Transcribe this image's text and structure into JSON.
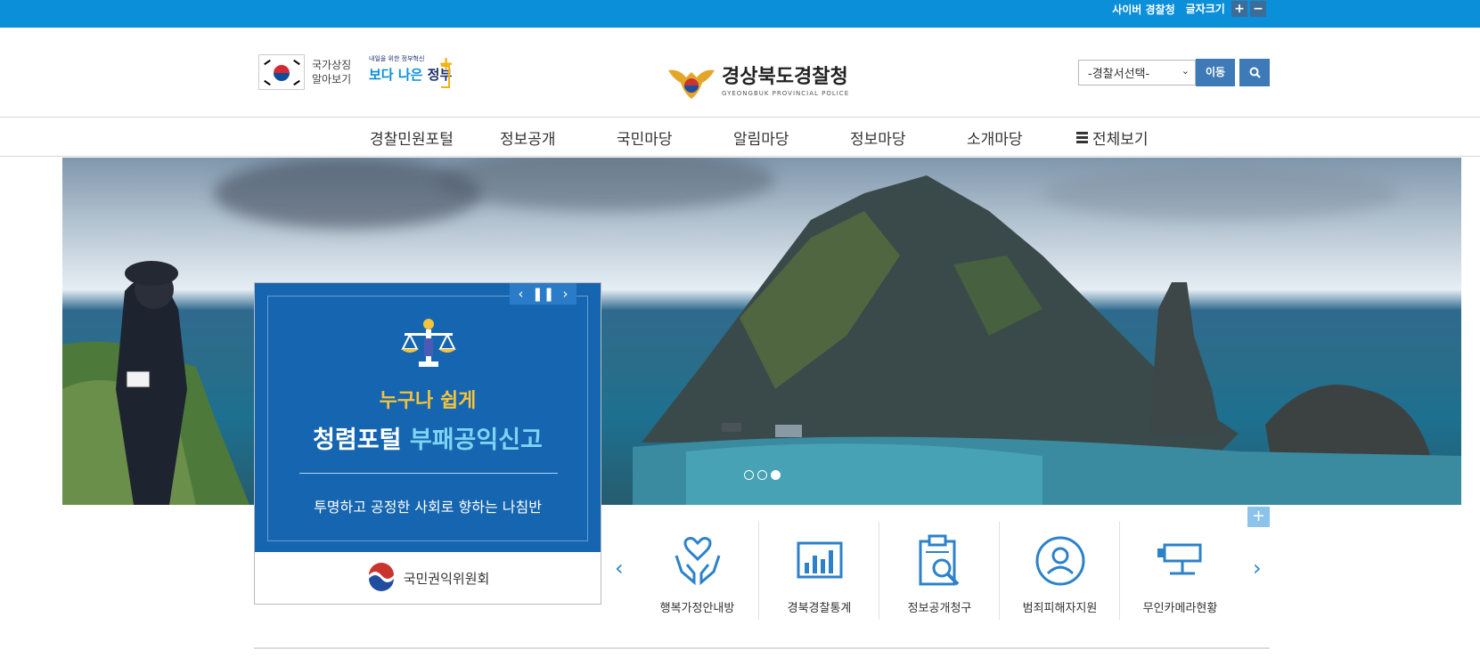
{
  "topbar": {
    "cyber_link": "사이버 경찰청",
    "font_size_label": "글자크기",
    "font_plus": "+",
    "font_minus": "−"
  },
  "header": {
    "symbol_line1": "국가상징",
    "symbol_line2": "알아보기",
    "gov_small": "내일을 위한 정부혁신",
    "gov_big_1": "보다 나은",
    "gov_big_2": "정부",
    "gov_plus": "+",
    "logo_ko": "경상북도경찰청",
    "logo_en": "GYEONGBUK PROVINCIAL POLICE",
    "station_select_value": "-경찰서선택-",
    "go_button": "이동"
  },
  "gnb": {
    "items": [
      "경찰민원포털",
      "정보공개",
      "국민마당",
      "알림마당",
      "정보마당",
      "소개마당"
    ],
    "all_view": "전체보기"
  },
  "banner": {
    "sub": "누구나 쉽게",
    "main_1": "청렴포털",
    "main_2": "부패공익신고",
    "desc": "투명하고 공정한 사회로 향하는 나침반",
    "org": "국민권익위원회"
  },
  "quick_links": [
    "행복가정안내방",
    "경북경찰통계",
    "정보공개청구",
    "범죄피해자지원",
    "무인카메라현황"
  ],
  "more_label": "+",
  "colors": {
    "topbar": "#0b8fd8",
    "button": "#3e7ab8",
    "banner": "#1565b0",
    "accent": "#2c82c9"
  }
}
